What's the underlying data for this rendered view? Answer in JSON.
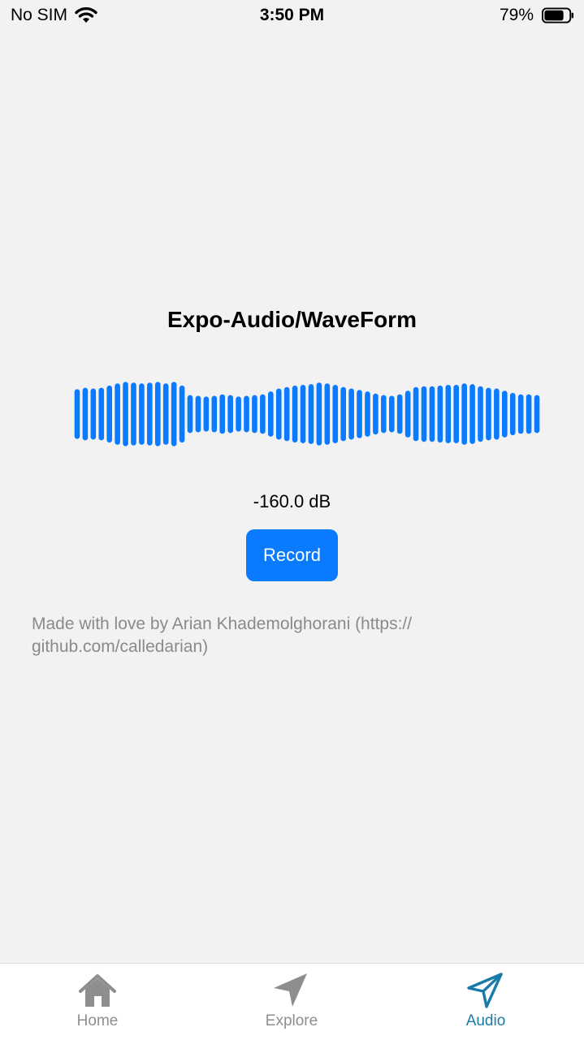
{
  "status_bar": {
    "carrier": "No SIM",
    "time": "3:50 PM",
    "battery": "79%",
    "battery_fraction": 0.79
  },
  "main": {
    "title": "Expo-Audio/WaveForm",
    "db_reading": "-160.0 dB",
    "record_label": "Record",
    "credits": "Made with love by Arian Khademolghorani (https:// github.com/calledarian)"
  },
  "waveform": {
    "color": "#0a7bff",
    "levels": [
      0.68,
      0.72,
      0.7,
      0.72,
      0.78,
      0.84,
      0.88,
      0.86,
      0.84,
      0.86,
      0.88,
      0.84,
      0.88,
      0.78,
      0.52,
      0.5,
      0.48,
      0.5,
      0.54,
      0.52,
      0.48,
      0.5,
      0.52,
      0.54,
      0.62,
      0.7,
      0.74,
      0.78,
      0.8,
      0.82,
      0.86,
      0.84,
      0.8,
      0.74,
      0.7,
      0.66,
      0.62,
      0.56,
      0.52,
      0.5,
      0.54,
      0.64,
      0.74,
      0.76,
      0.76,
      0.78,
      0.8,
      0.8,
      0.84,
      0.82,
      0.76,
      0.72,
      0.7,
      0.64,
      0.58,
      0.54,
      0.54,
      0.52
    ]
  },
  "tabs": [
    {
      "label": "Home",
      "icon": "home-icon",
      "active": false
    },
    {
      "label": "Explore",
      "icon": "paper-plane-filled-icon",
      "active": false
    },
    {
      "label": "Audio",
      "icon": "paper-plane-outline-icon",
      "active": true
    }
  ],
  "colors": {
    "accent": "#0a7bff",
    "active_tab": "#1a7aa8",
    "inactive_tab": "#8e8e8e",
    "background": "#f2f2f2"
  }
}
